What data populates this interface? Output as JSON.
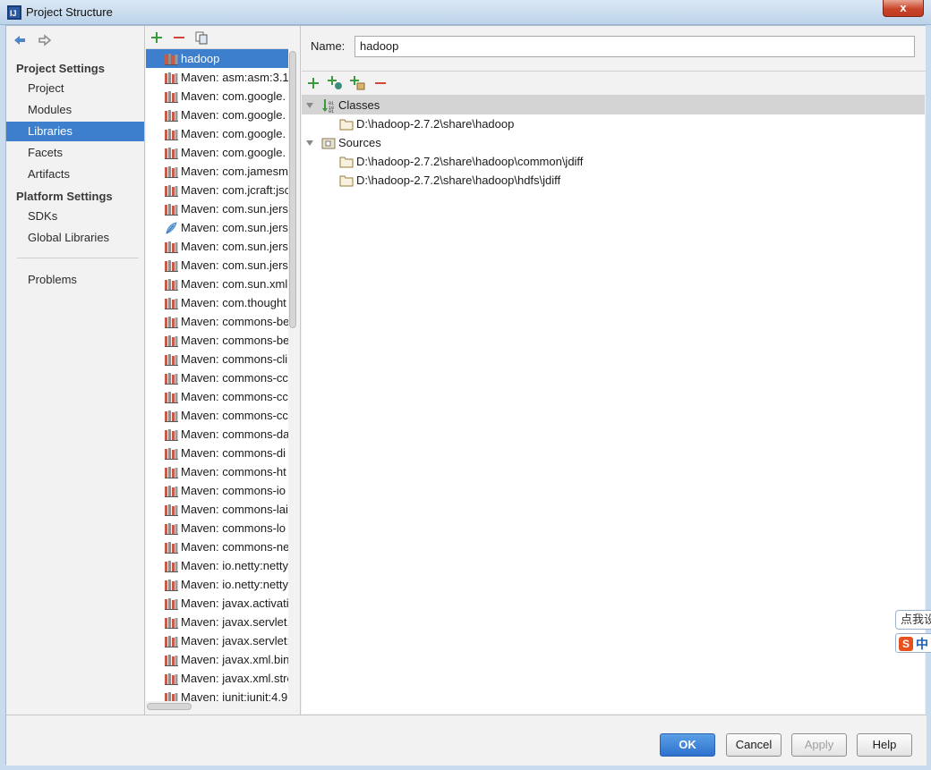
{
  "window": {
    "title": "Project Structure",
    "close": "x"
  },
  "nav": {
    "project_settings": "Project Settings",
    "platform_settings": "Platform Settings",
    "items": [
      {
        "label": "Project"
      },
      {
        "label": "Modules"
      },
      {
        "label": "Libraries",
        "selected": true
      },
      {
        "label": "Facets"
      },
      {
        "label": "Artifacts"
      },
      {
        "label": "SDKs"
      },
      {
        "label": "Global Libraries"
      },
      {
        "label": "Problems"
      }
    ]
  },
  "libraries": [
    {
      "label": "hadoop",
      "icon": "library-icon",
      "selected": true
    },
    {
      "label": "Maven: asm:asm:3.1",
      "icon": "library-icon"
    },
    {
      "label": "Maven: com.google.",
      "icon": "library-icon"
    },
    {
      "label": "Maven: com.google.",
      "icon": "library-icon"
    },
    {
      "label": "Maven: com.google.",
      "icon": "library-icon"
    },
    {
      "label": "Maven: com.google.",
      "icon": "library-icon"
    },
    {
      "label": "Maven: com.jamesm",
      "icon": "library-icon"
    },
    {
      "label": "Maven: com.jcraft:jsc",
      "icon": "library-icon"
    },
    {
      "label": "Maven: com.sun.jerse",
      "icon": "library-icon"
    },
    {
      "label": "Maven: com.sun.jerse",
      "icon": "feather-icon"
    },
    {
      "label": "Maven: com.sun.jerse",
      "icon": "library-icon"
    },
    {
      "label": "Maven: com.sun.jerse",
      "icon": "library-icon"
    },
    {
      "label": "Maven: com.sun.xml.",
      "icon": "library-icon"
    },
    {
      "label": "Maven: com.thought",
      "icon": "library-icon"
    },
    {
      "label": "Maven: commons-be",
      "icon": "library-icon"
    },
    {
      "label": "Maven: commons-be",
      "icon": "library-icon"
    },
    {
      "label": "Maven: commons-cli",
      "icon": "library-icon"
    },
    {
      "label": "Maven: commons-cc",
      "icon": "library-icon"
    },
    {
      "label": "Maven: commons-cc",
      "icon": "library-icon"
    },
    {
      "label": "Maven: commons-cc",
      "icon": "library-icon"
    },
    {
      "label": "Maven: commons-da",
      "icon": "library-icon"
    },
    {
      "label": "Maven: commons-di",
      "icon": "library-icon"
    },
    {
      "label": "Maven: commons-ht",
      "icon": "library-icon"
    },
    {
      "label": "Maven: commons-io",
      "icon": "library-icon"
    },
    {
      "label": "Maven: commons-lai",
      "icon": "library-icon"
    },
    {
      "label": "Maven: commons-lo",
      "icon": "library-icon"
    },
    {
      "label": "Maven: commons-ne",
      "icon": "library-icon"
    },
    {
      "label": "Maven: io.netty:netty",
      "icon": "library-icon"
    },
    {
      "label": "Maven: io.netty:netty",
      "icon": "library-icon"
    },
    {
      "label": "Maven: javax.activati",
      "icon": "library-icon"
    },
    {
      "label": "Maven: javax.servlet.j",
      "icon": "library-icon"
    },
    {
      "label": "Maven: javax.servlet:",
      "icon": "library-icon"
    },
    {
      "label": "Maven: javax.xml.bin",
      "icon": "library-icon"
    },
    {
      "label": "Maven: javax.xml.stre",
      "icon": "library-icon"
    },
    {
      "label": "Maven: junit:junit:4.9",
      "icon": "library-icon"
    }
  ],
  "detail": {
    "name_label": "Name:",
    "name_value": "hadoop",
    "tree": [
      {
        "type": "group",
        "label": "Classes",
        "icon": "classes-icon",
        "expanded": true,
        "highlight": true
      },
      {
        "type": "path",
        "label": "D:\\hadoop-2.7.2\\share\\hadoop",
        "icon": "folder-icon"
      },
      {
        "type": "group",
        "label": "Sources",
        "icon": "sources-icon",
        "expanded": true,
        "highlight": false
      },
      {
        "type": "path",
        "label": "D:\\hadoop-2.7.2\\share\\hadoop\\common\\jdiff",
        "icon": "folder-icon"
      },
      {
        "type": "path",
        "label": "D:\\hadoop-2.7.2\\share\\hadoop\\hdfs\\jdiff",
        "icon": "folder-icon"
      }
    ]
  },
  "buttons": {
    "ok": "OK",
    "cancel": "Cancel",
    "apply": "Apply",
    "help": "Help"
  },
  "ime": {
    "tip": "点我设",
    "mode": "中",
    "logo": "S"
  },
  "colors": {
    "selection": "#3d7fcd",
    "add": "#3c9a3c",
    "remove": "#d0473a"
  }
}
